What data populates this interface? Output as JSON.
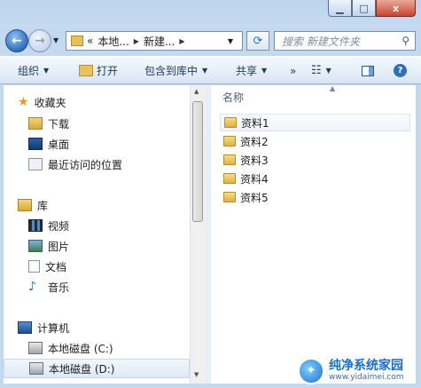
{
  "titlebar": {
    "minimize": "▁",
    "maximize": "□",
    "close": "x"
  },
  "nav": {
    "back": "←",
    "forward": "→",
    "address": {
      "overflow": "«",
      "crumb1": "本地...",
      "crumb2": "新建..."
    },
    "search_placeholder": "搜索 新建文件夹"
  },
  "toolbar": {
    "organize": "组织",
    "open": "打开",
    "include_in_library": "包含到库中",
    "share": "共享",
    "more": "»"
  },
  "sidebar": {
    "favorites": {
      "header": "收藏夹",
      "items": [
        "下载",
        "桌面",
        "最近访问的位置"
      ]
    },
    "libraries": {
      "header": "库",
      "items": [
        "视频",
        "图片",
        "文档",
        "音乐"
      ]
    },
    "computer": {
      "header": "计算机",
      "items": [
        "本地磁盘 (C:)",
        "本地磁盘 (D:)"
      ]
    }
  },
  "content": {
    "column_name": "名称",
    "items": [
      "资料1",
      "资料2",
      "资料3",
      "资料4",
      "资料5"
    ]
  },
  "watermark": {
    "main": "纯净系统家园",
    "url": "www.yidaimei.com"
  },
  "colors": {
    "accent": "#1e70c8",
    "frame": "#c5d9ee"
  }
}
